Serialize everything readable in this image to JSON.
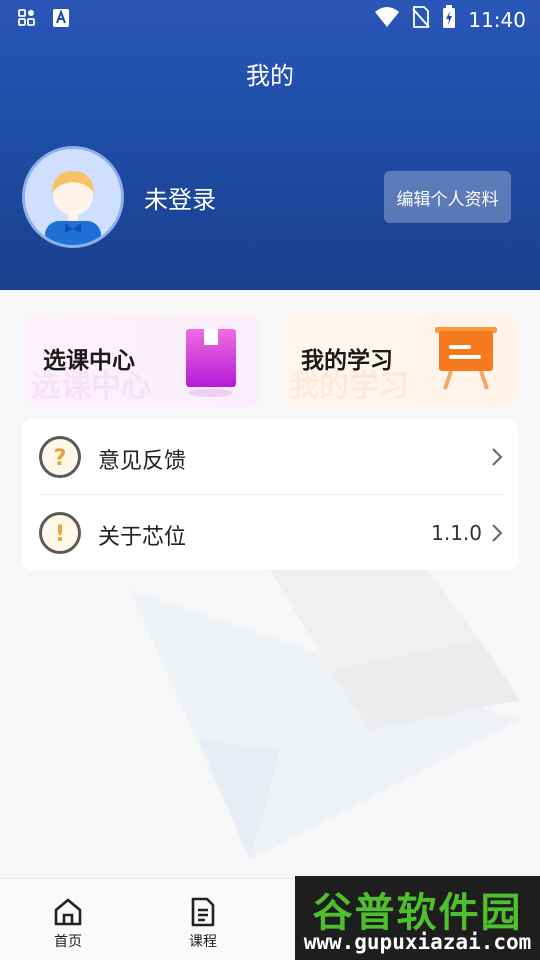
{
  "status_bar": {
    "time": "11:40",
    "left_icons": [
      "grid-icon",
      "font-a-icon"
    ],
    "right_icons": [
      "wifi-icon",
      "no-sim-icon",
      "battery-charging-icon"
    ]
  },
  "header": {
    "title": "我的",
    "user_name": "未登录",
    "edit_profile_label": "编辑个人资料"
  },
  "cards": [
    {
      "title": "选课中心",
      "watermark": "选课中心",
      "icon": "book-icon",
      "accent": "#c52bd8"
    },
    {
      "title": "我的学习",
      "watermark": "我的学习",
      "icon": "easel-icon",
      "accent": "#f57a1d"
    }
  ],
  "menu": [
    {
      "label": "意见反馈",
      "icon": "question-icon",
      "value": ""
    },
    {
      "label": "关于芯位",
      "icon": "exclamation-icon",
      "value": "1.1.0"
    }
  ],
  "tabbar": [
    {
      "label": "首页",
      "icon": "home-icon"
    },
    {
      "label": "课程",
      "icon": "document-icon"
    }
  ],
  "watermark": {
    "title": "谷普软件园",
    "url": "www.gupuxiazai.com"
  },
  "colors": {
    "header_top": "#2a56b8",
    "header_bottom": "#1a3f8c",
    "background": "#f7f7f8"
  }
}
